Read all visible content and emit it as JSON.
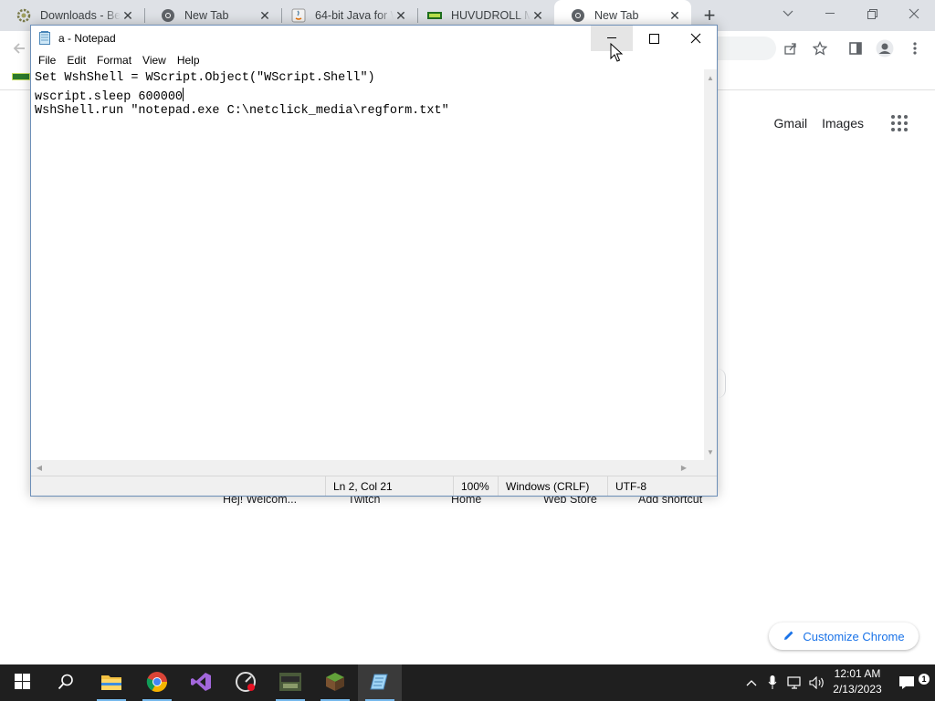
{
  "chrome": {
    "tabs": [
      {
        "title": "Downloads - Be",
        "icon": "settings-favicon"
      },
      {
        "title": "New Tab",
        "icon": "chrome-favicon"
      },
      {
        "title": "64-bit Java for W",
        "icon": "java-favicon"
      },
      {
        "title": "HUVUDROLL M",
        "icon": "site-favicon"
      },
      {
        "title": "New Tab",
        "icon": "chrome-favicon"
      }
    ],
    "ntp_links": {
      "gmail": "Gmail",
      "images": "Images"
    },
    "shortcuts": [
      "Hej! Welcom...",
      "Twitch",
      "Home",
      "Web Store",
      "Add shortcut"
    ],
    "customize_label": "Customize Chrome"
  },
  "notepad": {
    "title": "a - Notepad",
    "menu": [
      "File",
      "Edit",
      "Format",
      "View",
      "Help"
    ],
    "lines": [
      "Set WshShell = WScript.Object(\"WScript.Shell\")",
      "wscript.sleep 600000",
      "WshShell.run \"notepad.exe C:\\netclick_media\\regform.txt\""
    ],
    "status": {
      "position": "Ln 2, Col 21",
      "zoom": "100%",
      "line_ending": "Windows (CRLF)",
      "encoding": "UTF-8"
    }
  },
  "taskbar": {
    "apps": [
      "start-icon",
      "search-icon",
      "file-explorer-icon",
      "chrome-icon",
      "visual-studio-icon",
      "recorder-icon",
      "game-icon",
      "minecraft-icon",
      "notepad-icon"
    ],
    "time": "12:01 AM",
    "date": "2/13/2023"
  },
  "colors": {
    "accent": "#1a73e8",
    "taskbar": "#1f1f1f",
    "tabstrip": "#dee1e6"
  }
}
